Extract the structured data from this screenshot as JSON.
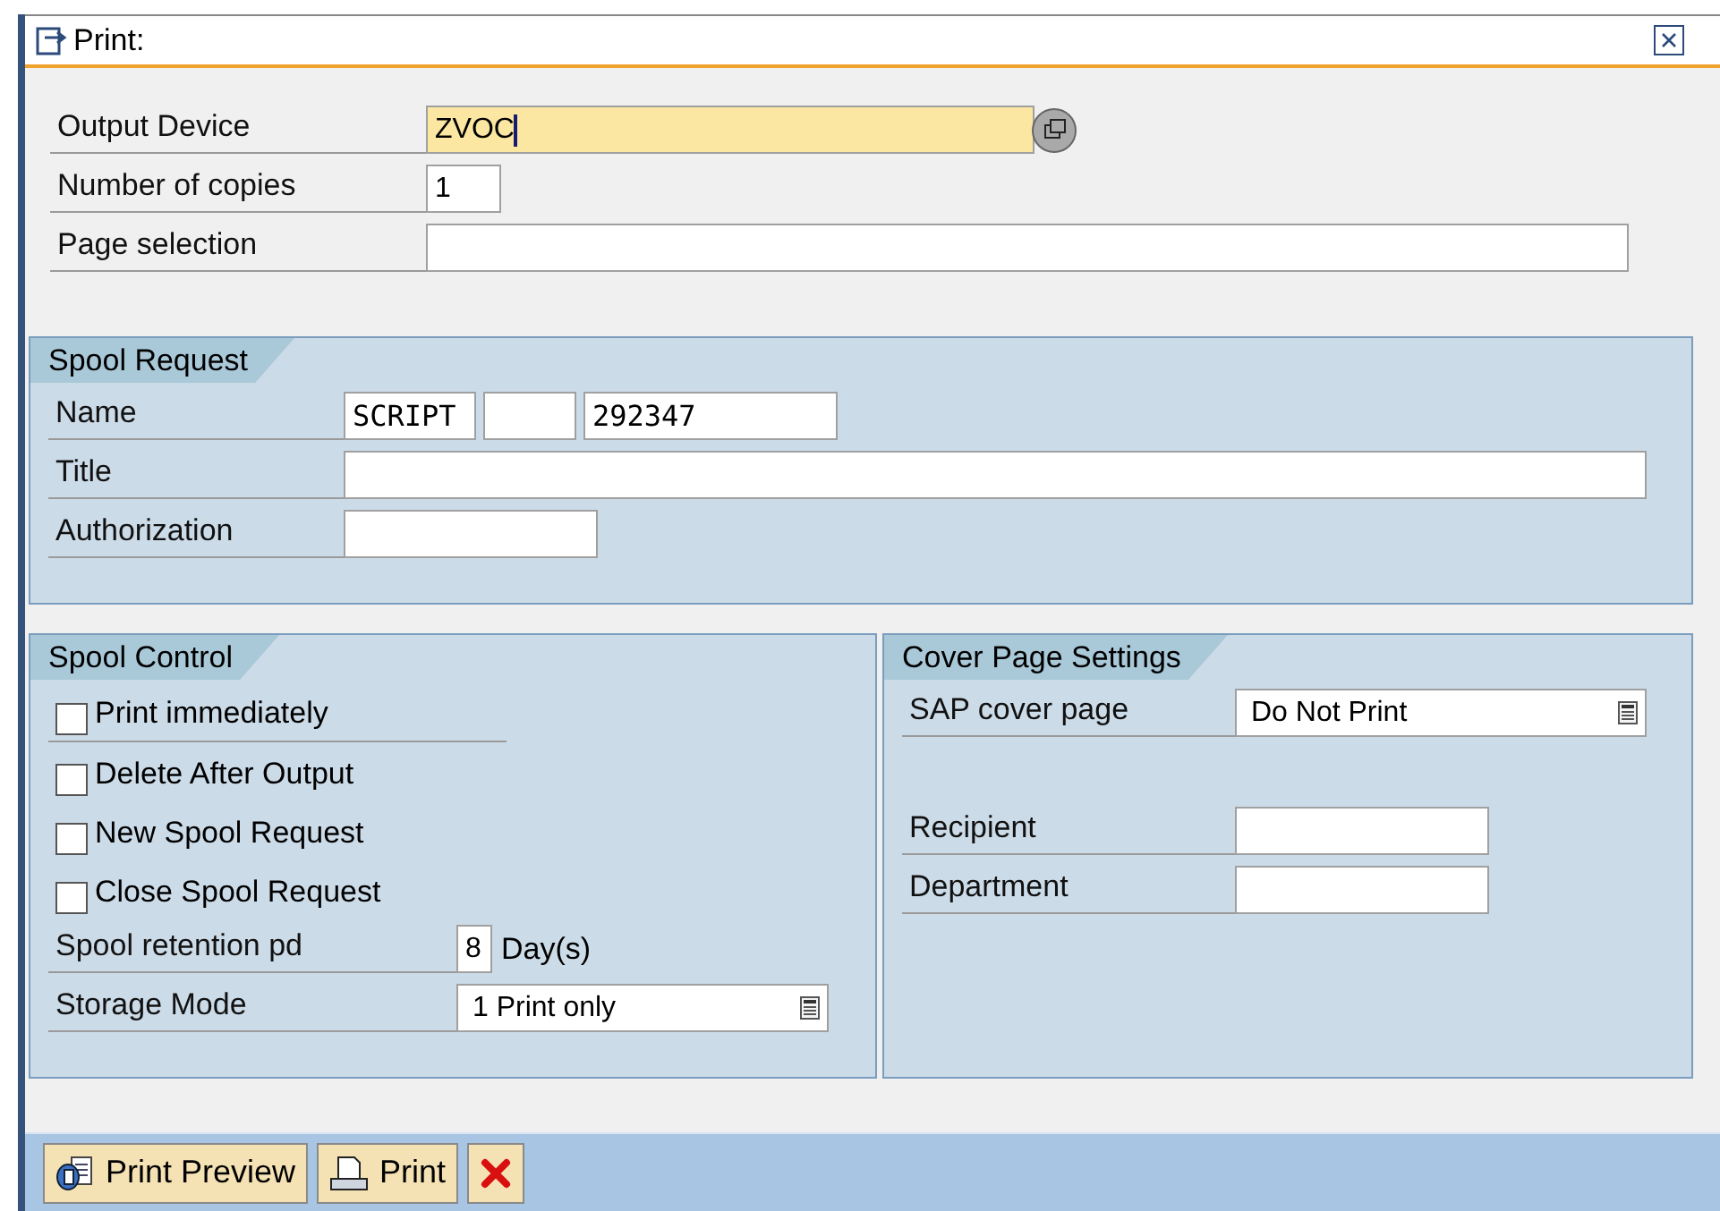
{
  "window": {
    "title": "Print:"
  },
  "top_fields": [
    {
      "label": "Output Device",
      "kind": "device",
      "value": "ZVOC",
      "focused": true
    },
    {
      "label": "Number of copies",
      "kind": "number",
      "value": "1",
      "focused": false
    },
    {
      "label": "Page selection",
      "kind": "wide",
      "focused": false
    }
  ],
  "spool_request": {
    "title": "Spool Request",
    "fields": [
      {
        "label": "Name",
        "kind": "name",
        "parts": [
          "SCRIPT",
          "292347"
        ]
      },
      {
        "label": "Title",
        "kind": "full"
      },
      {
        "label": "Authorization",
        "kind": "short"
      }
    ]
  },
  "spool_control": {
    "title": "Spool Control",
    "checkboxes": [
      {
        "label": "Print immediately",
        "checked": false
      },
      {
        "label": "Delete After Output",
        "checked": false
      },
      {
        "label": "New Spool Request",
        "checked": false
      },
      {
        "label": "Close Spool Request",
        "checked": false
      }
    ],
    "retention": {
      "label": "Spool retention pd",
      "value": "8",
      "unit": "Day(s)"
    },
    "storage": {
      "label": "Storage Mode",
      "value": "1 Print only"
    }
  },
  "cover_page": {
    "title": "Cover Page Settings",
    "fields": [
      {
        "label": "SAP cover page",
        "kind": "dropdown",
        "value": "Do Not Print"
      },
      {
        "label": "Recipient",
        "kind": "short"
      },
      {
        "label": "Department",
        "kind": "short"
      }
    ]
  },
  "buttons": [
    {
      "kind": "preview",
      "label": "Print Preview"
    },
    {
      "kind": "print",
      "label": "Print"
    },
    {
      "kind": "cancel"
    }
  ]
}
